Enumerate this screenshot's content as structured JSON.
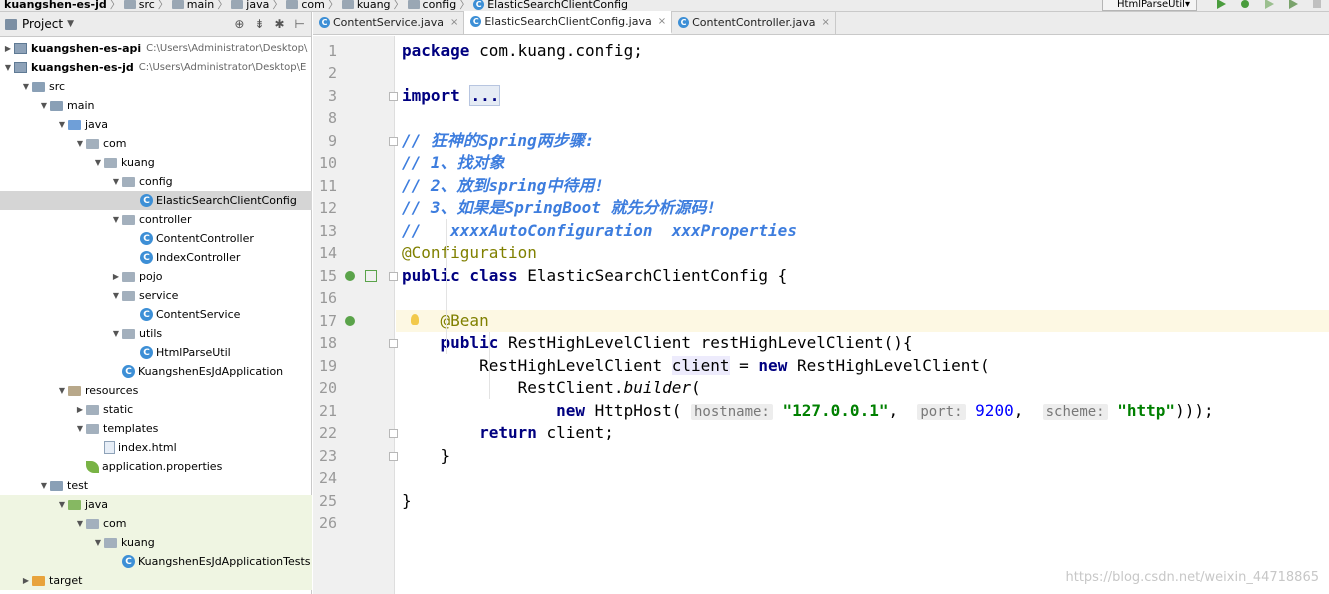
{
  "navbar": {
    "crumbs": [
      "kuangshen-es-jd",
      "src",
      "main",
      "java",
      "com",
      "kuang",
      "config",
      "ElasticSearchClientConfig"
    ],
    "run_config": "HtmlParseUtil"
  },
  "project": {
    "title": "Project",
    "tree": [
      {
        "label": "kuangshen-es-api",
        "path": "C:\\Users\\Administrator\\Desktop\\",
        "type": "module",
        "depth": 0,
        "arrow": "right"
      },
      {
        "label": "kuangshen-es-jd",
        "path": "C:\\Users\\Administrator\\Desktop\\E",
        "type": "module",
        "depth": 0,
        "arrow": "down"
      },
      {
        "label": "src",
        "type": "folder-src",
        "depth": 1,
        "arrow": "down"
      },
      {
        "label": "main",
        "type": "folder-src",
        "depth": 2,
        "arrow": "down"
      },
      {
        "label": "java",
        "type": "folder-java",
        "depth": 3,
        "arrow": "down"
      },
      {
        "label": "com",
        "type": "folder",
        "depth": 4,
        "arrow": "down"
      },
      {
        "label": "kuang",
        "type": "folder",
        "depth": 5,
        "arrow": "down"
      },
      {
        "label": "config",
        "type": "folder",
        "depth": 6,
        "arrow": "down"
      },
      {
        "label": "ElasticSearchClientConfig",
        "type": "class",
        "depth": 7,
        "arrow": "none",
        "selected": true
      },
      {
        "label": "controller",
        "type": "folder",
        "depth": 6,
        "arrow": "down"
      },
      {
        "label": "ContentController",
        "type": "class",
        "depth": 7,
        "arrow": "none"
      },
      {
        "label": "IndexController",
        "type": "class",
        "depth": 7,
        "arrow": "none"
      },
      {
        "label": "pojo",
        "type": "folder",
        "depth": 6,
        "arrow": "right"
      },
      {
        "label": "service",
        "type": "folder",
        "depth": 6,
        "arrow": "down"
      },
      {
        "label": "ContentService",
        "type": "class",
        "depth": 7,
        "arrow": "none"
      },
      {
        "label": "utils",
        "type": "folder",
        "depth": 6,
        "arrow": "down"
      },
      {
        "label": "HtmlParseUtil",
        "type": "class",
        "depth": 7,
        "arrow": "none"
      },
      {
        "label": "KuangshenEsJdApplication",
        "type": "class-app",
        "depth": 6,
        "arrow": "none"
      },
      {
        "label": "resources",
        "type": "folder-res",
        "depth": 3,
        "arrow": "down"
      },
      {
        "label": "static",
        "type": "folder",
        "depth": 4,
        "arrow": "right"
      },
      {
        "label": "templates",
        "type": "folder",
        "depth": 4,
        "arrow": "down"
      },
      {
        "label": "index.html",
        "type": "file",
        "depth": 5,
        "arrow": "none"
      },
      {
        "label": "application.properties",
        "type": "leaf",
        "depth": 4,
        "arrow": "none"
      },
      {
        "label": "test",
        "type": "folder-src",
        "depth": 2,
        "arrow": "down"
      },
      {
        "label": "java",
        "type": "folder-test",
        "depth": 3,
        "arrow": "down",
        "test": true
      },
      {
        "label": "com",
        "type": "folder",
        "depth": 4,
        "arrow": "down",
        "test": true
      },
      {
        "label": "kuang",
        "type": "folder",
        "depth": 5,
        "arrow": "down",
        "test": true
      },
      {
        "label": "KuangshenEsJdApplicationTests",
        "type": "class-app",
        "depth": 6,
        "arrow": "none",
        "test": true
      },
      {
        "label": "target",
        "type": "folder-target",
        "depth": 1,
        "arrow": "right",
        "test": true
      }
    ]
  },
  "editor": {
    "tabs": [
      {
        "label": "ContentService.java",
        "active": false
      },
      {
        "label": "ElasticSearchClientConfig.java",
        "active": true
      },
      {
        "label": "ContentController.java",
        "active": false
      }
    ],
    "lines": [
      {
        "n": "1",
        "html": "<span class=\"kw\">package</span> com.kuang.config;"
      },
      {
        "n": "2",
        "html": ""
      },
      {
        "n": "3",
        "html": "<span class=\"kw\">import</span> <span class=\"fold-box\">...</span>"
      },
      {
        "n": "8",
        "html": ""
      },
      {
        "n": "9",
        "html": "<span class=\"cm\">// 狂神的Spring两步骤:</span>"
      },
      {
        "n": "10",
        "html": "<span class=\"cm\">// 1、找对象</span>"
      },
      {
        "n": "11",
        "html": "<span class=\"cm\">// 2、放到spring中待用!</span>"
      },
      {
        "n": "12",
        "html": "<span class=\"cm\">// 3、如果是SpringBoot 就先分析源码!</span>"
      },
      {
        "n": "13",
        "html": "<span class=\"cm\">//   xxxxAutoConfiguration  xxxProperties</span>"
      },
      {
        "n": "14",
        "html": "<span class=\"an\">@Configuration</span>"
      },
      {
        "n": "15",
        "html": "<span class=\"kw\">public class</span> ElasticSearchClientConfig {"
      },
      {
        "n": "16",
        "html": ""
      },
      {
        "n": "17",
        "html": "    <span class=\"an\">@Bean</span>"
      },
      {
        "n": "18",
        "html": "    <span class=\"kw\">public</span> RestHighLevelClient restHighLevelClient(){"
      },
      {
        "n": "19",
        "html": "        RestHighLevelClient <span class=\"hl-var\">client</span> = <span class=\"kw\">new</span> RestHighLevelClient("
      },
      {
        "n": "20",
        "html": "            RestClient.<span class=\"it\">builder</span>("
      },
      {
        "n": "21",
        "html": "                <span class=\"kw\">new</span> HttpHost( <span class=\"hint\">hostname:</span> <span class=\"str\">\"127.0.0.1\"</span>,  <span class=\"hint\">port:</span> <span class=\"num\">9200</span>,  <span class=\"hint\">scheme:</span> <span class=\"str\">\"http\"</span>)));"
      },
      {
        "n": "22",
        "html": "        <span class=\"kw\">return</span> client;"
      },
      {
        "n": "23",
        "html": "    }"
      },
      {
        "n": "24",
        "html": ""
      },
      {
        "n": "25",
        "html": "}"
      },
      {
        "n": "26",
        "html": ""
      }
    ]
  },
  "watermark": "https://blog.csdn.net/weixin_44718865"
}
